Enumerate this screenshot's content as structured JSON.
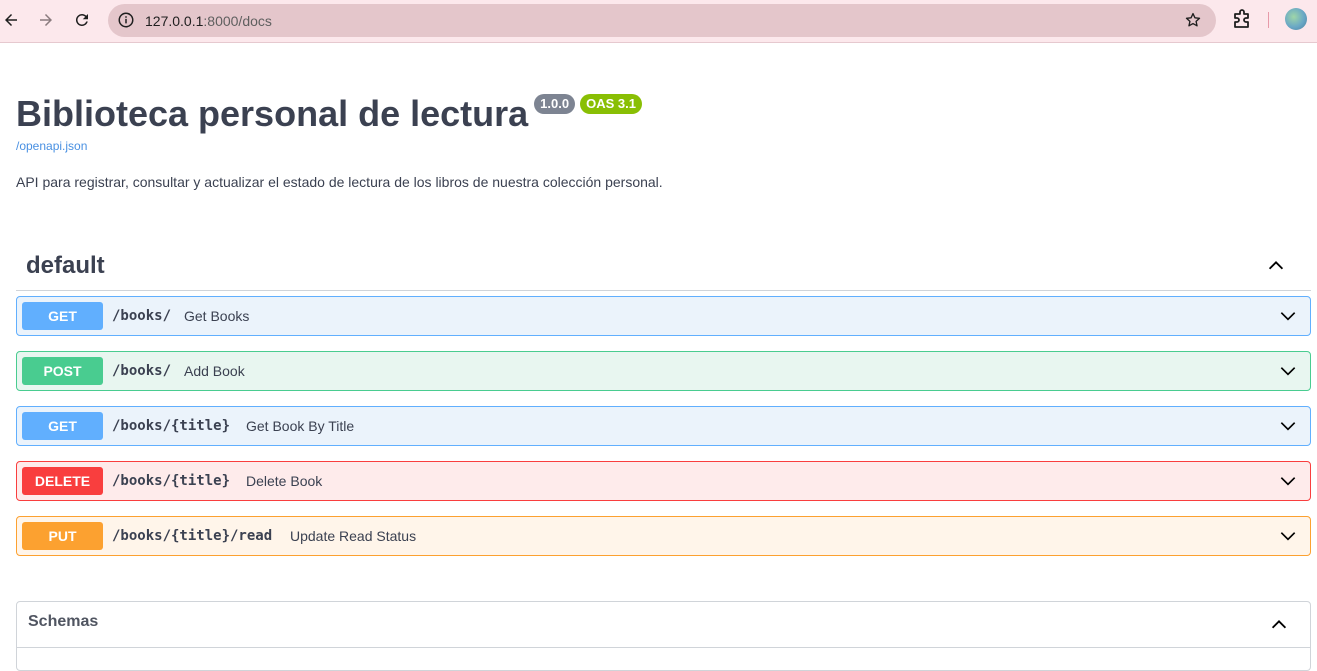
{
  "browser": {
    "url_host": "127.0.0.1",
    "url_rest": ":8000/docs"
  },
  "info": {
    "title": "Biblioteca personal de lectura",
    "version": "1.0.0",
    "oas": "OAS 3.1",
    "spec_link": "/openapi.json",
    "description": "API para registrar, consultar y actualizar el estado de lectura de los libros de nuestra colección personal."
  },
  "section": {
    "title": "default"
  },
  "operations": [
    {
      "method": "GET",
      "path": "/books/",
      "summary": "Get Books"
    },
    {
      "method": "POST",
      "path": "/books/",
      "summary": "Add Book"
    },
    {
      "method": "GET",
      "path": "/books/{title}",
      "summary": "Get Book By Title"
    },
    {
      "method": "DELETE",
      "path": "/books/{title}",
      "summary": "Delete Book"
    },
    {
      "method": "PUT",
      "path": "/books/{title}/read",
      "summary": "Update Read Status"
    }
  ],
  "schemas": {
    "title": "Schemas"
  },
  "colors": {
    "get": "#61affe",
    "post": "#49cc90",
    "delete": "#f93e3e",
    "put": "#fca130",
    "oas_badge": "#89bf04",
    "version_badge": "#7d8492"
  },
  "icons": {
    "back": "arrow-left-icon",
    "forward": "arrow-right-icon",
    "reload": "reload-icon",
    "site_info": "info-icon",
    "bookmark": "star-icon",
    "extensions": "puzzle-icon",
    "profile": "avatar",
    "expand": "chevron-down-icon",
    "collapse": "chevron-up-icon"
  }
}
